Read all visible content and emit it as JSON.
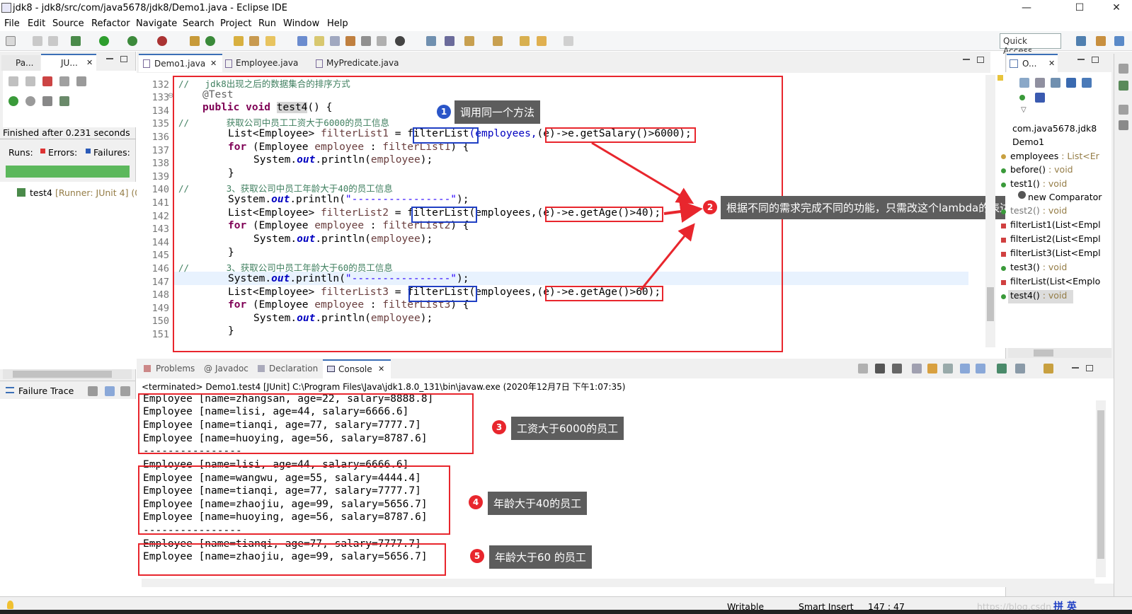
{
  "window": {
    "title": "jdk8 - jdk8/src/com/java5678/jdk8/Demo1.java - Eclipse IDE",
    "min": "—",
    "max": "☐",
    "close": "✕"
  },
  "menu": [
    "File",
    "Edit",
    "Source",
    "Refactor",
    "Navigate",
    "Search",
    "Project",
    "Run",
    "Window",
    "Help"
  ],
  "toolbar": {
    "quick_access": "Quick Access"
  },
  "left_panel": {
    "tabs": [
      "Pa...",
      "JU..."
    ],
    "finished": "Finished after 0.231 seconds",
    "runs_label": "Runs:",
    "errors_label": "Errors:",
    "failures_label": "Failures:",
    "test_item": "test4",
    "test_runner": "[Runner: JUnit 4] (0.",
    "failure_trace": "Failure Trace",
    "bar_color": "#5cb85c"
  },
  "editor": {
    "tabs": [
      "Demo1.java",
      "Employee.java",
      "MyPredicate.java"
    ],
    "line_numbers": [
      "132",
      "133",
      "134",
      "135",
      "136",
      "137",
      "138",
      "139",
      "140",
      "141",
      "142",
      "143",
      "144",
      "145",
      "146",
      "147",
      "148",
      "149",
      "150",
      "151"
    ],
    "fold_marker": "⊖"
  },
  "callouts": {
    "c1": {
      "num": "1",
      "text": "调用同一个方法"
    },
    "c2": {
      "num": "2",
      "text": "根据不同的需求完成不同的功能，只需改这个lambda的表达式就OK来"
    },
    "c3": {
      "num": "3",
      "text": "工资大于6000的员工"
    },
    "c4": {
      "num": "4",
      "text": "年龄大于40的员工"
    },
    "c5": {
      "num": "5",
      "text": "年龄大于60 的员工"
    }
  },
  "outline": {
    "tab": "O...",
    "package": "com.java5678.jdk8",
    "class": "Demo1",
    "items": [
      {
        "name": "employees",
        "type": " : List<Er"
      },
      {
        "name": "before()",
        "type": " : void"
      },
      {
        "name": "test1()",
        "type": " : void"
      },
      {
        "name": "new Comparator",
        "type": ""
      },
      {
        "name": "test2()",
        "type": " : void"
      },
      {
        "name": "filterList1(List<Empl",
        "type": ""
      },
      {
        "name": "filterList2(List<Empl",
        "type": ""
      },
      {
        "name": "filterList3(List<Empl",
        "type": ""
      },
      {
        "name": "test3()",
        "type": " : void"
      },
      {
        "name": "filterList(List<Emplo",
        "type": ""
      },
      {
        "name": "test4()",
        "type": " : void"
      }
    ]
  },
  "bottom": {
    "tabs": [
      "Problems",
      "Javadoc",
      "Declaration",
      "Console"
    ],
    "terminated": "<terminated> Demo1.test4 [JUnit] C:\\Program Files\\Java\\jdk1.8.0_131\\bin\\javaw.exe (2020年12月7日 下午1:07:35)",
    "lines": [
      "Employee [name=zhangsan, age=22, salary=8888.8]",
      "Employee [name=lisi, age=44, salary=6666.6]",
      "Employee [name=tianqi, age=77, salary=7777.7]",
      "Employee [name=huoying, age=56, salary=8787.6]",
      "----------------",
      "Employee [name=lisi, age=44, salary=6666.6]",
      "Employee [name=wangwu, age=55, salary=4444.4]",
      "Employee [name=tianqi, age=77, salary=7777.7]",
      "Employee [name=zhaojiu, age=99, salary=5656.7]",
      "Employee [name=huoying, age=56, salary=8787.6]",
      "----------------",
      "Employee [name=tianqi, age=77, salary=7777.7]",
      "Employee [name=zhaojiu, age=99, salary=5656.7]"
    ]
  },
  "status": {
    "writable": "Writable",
    "insert": "Smart Insert",
    "position": "147 : 47",
    "watermark": "https://blog.csdn",
    "ime": "拼 英"
  },
  "code": {
    "l132_comment": "//   jdk8出现之后的数据集合的排序方式",
    "l133_annot": "@Test",
    "l134_kw": "public void ",
    "l134_name": "test4",
    "l134_rest": "() {",
    "l135_comment": "//       获取公司中员工工资大于6000的员工信息",
    "l136_a": "List<Employee> ",
    "l136_var": "filterList1",
    "l136_b": " = ",
    "l136_call": "filterList",
    "l136_c": "(employees,",
    "l136_lambda": "(e)->e.getSalary()>6000",
    "l136_d": ");",
    "l137_kw": "for",
    "l137_a": " (Employee ",
    "l137_var": "employee",
    "l137_b": " : ",
    "l137_var2": "filterList1",
    "l137_c": ") {",
    "l138_a": "System.",
    "l138_out": "out",
    "l138_b": ".println(",
    "l138_var": "employee",
    "l138_c": ");",
    "l139": "}",
    "l140_comment": "//       3、获取公司中员工年龄大于40的员工信息",
    "l141_a": "System.",
    "l141_out": "out",
    "l141_b": ".println(",
    "l141_str": "\"----------------\"",
    "l141_c": ");",
    "l142_a": "List<Employee> ",
    "l142_var": "filterList2",
    "l142_b": " = ",
    "l142_call": "filterList",
    "l142_c": "(employees,",
    "l142_lambda": "(e)->e.getAge()>40",
    "l142_d": ");",
    "l143_kw": "for",
    "l143_a": " (Employee ",
    "l143_var": "employee",
    "l143_b": " : ",
    "l143_var2": "filterList2",
    "l143_c": ") {",
    "l144_a": "System.",
    "l144_out": "out",
    "l144_b": ".println(",
    "l144_var": "employee",
    "l144_c": ");",
    "l145": "}",
    "l146_comment": "//       3、获取公司中员工年龄大于60的员工信息",
    "l147_a": "System.",
    "l147_out": "out",
    "l147_b": ".println(",
    "l147_str": "\"----------------\"",
    "l147_c": ");",
    "l148_a": "List<Employee> ",
    "l148_var": "filterList3",
    "l148_b": " = ",
    "l148_call": "filterList",
    "l148_c": "(employees,",
    "l148_lambda": "(e)->e.getAge()>60",
    "l148_d": ");",
    "l149_kw": "for",
    "l149_a": " (Employee ",
    "l149_var": "employee",
    "l149_b": " : ",
    "l149_var2": "filterList3",
    "l149_c": ") {",
    "l150_a": "System.",
    "l150_out": "out",
    "l150_b": ".println(",
    "l150_var": "employee",
    "l150_c": ");",
    "l151": "}"
  }
}
